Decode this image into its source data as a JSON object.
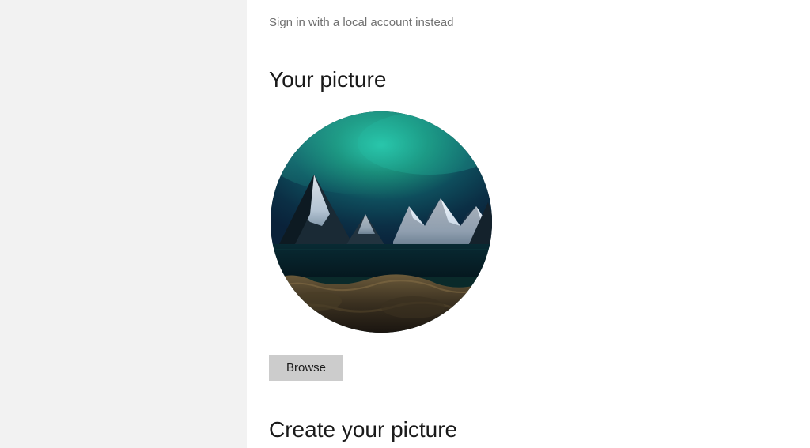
{
  "signin_link": "Sign in with a local account instead",
  "sections": {
    "picture": {
      "heading": "Your picture",
      "browse_label": "Browse"
    },
    "create": {
      "heading": "Create your picture"
    }
  }
}
